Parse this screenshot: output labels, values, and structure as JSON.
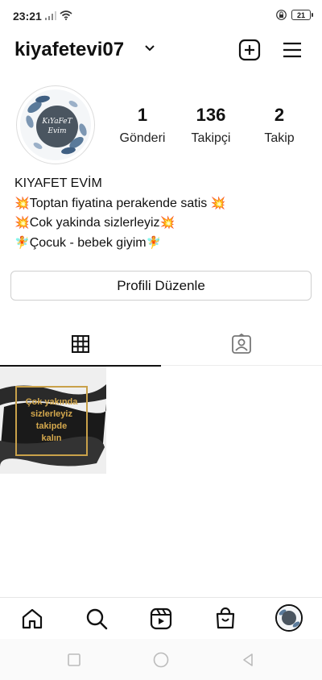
{
  "status_bar": {
    "time": "23:21",
    "battery": "21"
  },
  "header": {
    "username": "kiyafetevi07"
  },
  "avatar": {
    "text_line1": "KıYaFeT",
    "text_line2": "Evim"
  },
  "stats": [
    {
      "value": "1",
      "label": "Gönderi"
    },
    {
      "value": "136",
      "label": "Takipçi"
    },
    {
      "value": "2",
      "label": "Takip"
    }
  ],
  "bio": {
    "name": "KIYAFET EVİM",
    "line1": "Toptan fiyatina perakende satis",
    "line2": "Cok yakinda sizlerleyiz",
    "line3": "Çocuk - bebek giyim"
  },
  "edit_button": "Profili Düzenle",
  "post": {
    "line1": "Çok yakında",
    "line2": "sizlerleyiz",
    "line3": "takipde",
    "line4": "kalın"
  },
  "colors": {
    "accent": "#111111",
    "border": "#cfcfcf",
    "post_gold": "#c9a14a"
  }
}
